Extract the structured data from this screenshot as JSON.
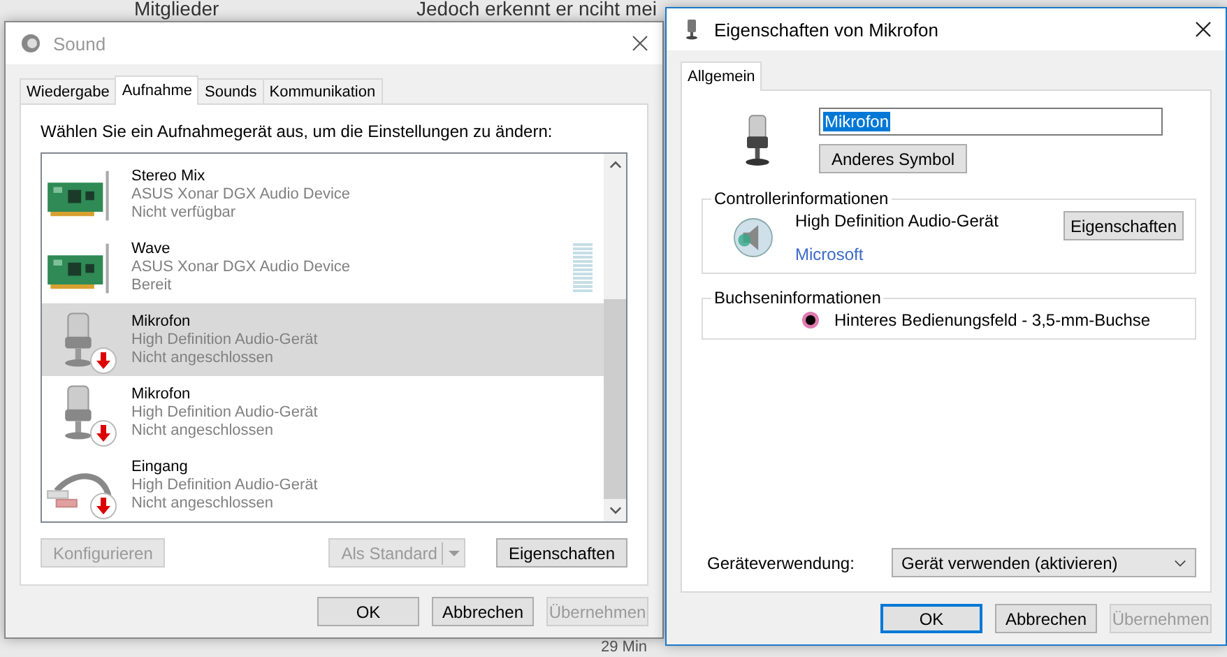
{
  "background": {
    "texts": [
      {
        "text": "Mitglieder"
      },
      {
        "text": "Jedoch erkennt er nciht mei"
      },
      {
        "text": "29 Min"
      }
    ]
  },
  "sound_window": {
    "title": "Sound",
    "tabs": [
      {
        "label": "Wiedergabe",
        "selected": false
      },
      {
        "label": "Aufnahme",
        "selected": true
      },
      {
        "label": "Sounds",
        "selected": false
      },
      {
        "label": "Kommunikation",
        "selected": false
      }
    ],
    "instruction": "Wählen Sie ein Aufnahmegerät aus, um die Einstellungen zu ändern:",
    "devices": [
      {
        "kind": "card",
        "name": "Stereo Mix",
        "driver": "ASUS Xonar DGX Audio Device",
        "status": "Nicht verfügbar",
        "selected": false,
        "disconnected": false
      },
      {
        "kind": "card",
        "name": "Wave",
        "driver": "ASUS Xonar DGX Audio Device",
        "status": "Bereit",
        "selected": false,
        "disconnected": false,
        "level": 0
      },
      {
        "kind": "mic",
        "name": "Mikrofon",
        "driver": "High Definition Audio-Gerät",
        "status": "Nicht angeschlossen",
        "selected": true,
        "disconnected": true
      },
      {
        "kind": "mic",
        "name": "Mikrofon",
        "driver": "High Definition Audio-Gerät",
        "status": "Nicht angeschlossen",
        "selected": false,
        "disconnected": true
      },
      {
        "kind": "cable",
        "name": "Eingang",
        "driver": "High Definition Audio-Gerät",
        "status": "Nicht angeschlossen",
        "selected": false,
        "disconnected": true
      }
    ],
    "panel_buttons": [
      {
        "label": "Konfigurieren",
        "kind": "plain",
        "disabled": true
      },
      {
        "label": "Als Standard",
        "kind": "split",
        "disabled": true
      },
      {
        "label": "Eigenschaften",
        "kind": "plain",
        "disabled": false
      }
    ],
    "buttons": [
      {
        "label": "OK",
        "disabled": false,
        "default": false
      },
      {
        "label": "Abbrechen",
        "disabled": false,
        "default": false
      },
      {
        "label": "Übernehmen",
        "disabled": true,
        "default": false
      }
    ]
  },
  "properties_window": {
    "title": "Eigenschaften von Mikrofon",
    "tabs": [
      {
        "label": "Allgemein",
        "selected": true
      }
    ],
    "name_field": {
      "value": "Mikrofon",
      "selected": true
    },
    "change_icon_button": "Anderes Symbol",
    "controller": {
      "legend": "Controllerinformationen",
      "name": "High Definition Audio-Gerät",
      "vendor": "Microsoft",
      "button": "Eigenschaften"
    },
    "jack": {
      "legend": "Buchseninformationen",
      "text": "Hinteres Bedienungsfeld - 3,5-mm-Buchse",
      "color": "#e07ab0"
    },
    "usage": {
      "label": "Geräteverwendung:",
      "value": "Gerät verwenden (aktivieren)"
    },
    "buttons": [
      {
        "label": "OK",
        "disabled": false,
        "default": true
      },
      {
        "label": "Abbrechen",
        "disabled": false,
        "default": false
      },
      {
        "label": "Übernehmen",
        "disabled": true,
        "default": false
      }
    ]
  }
}
